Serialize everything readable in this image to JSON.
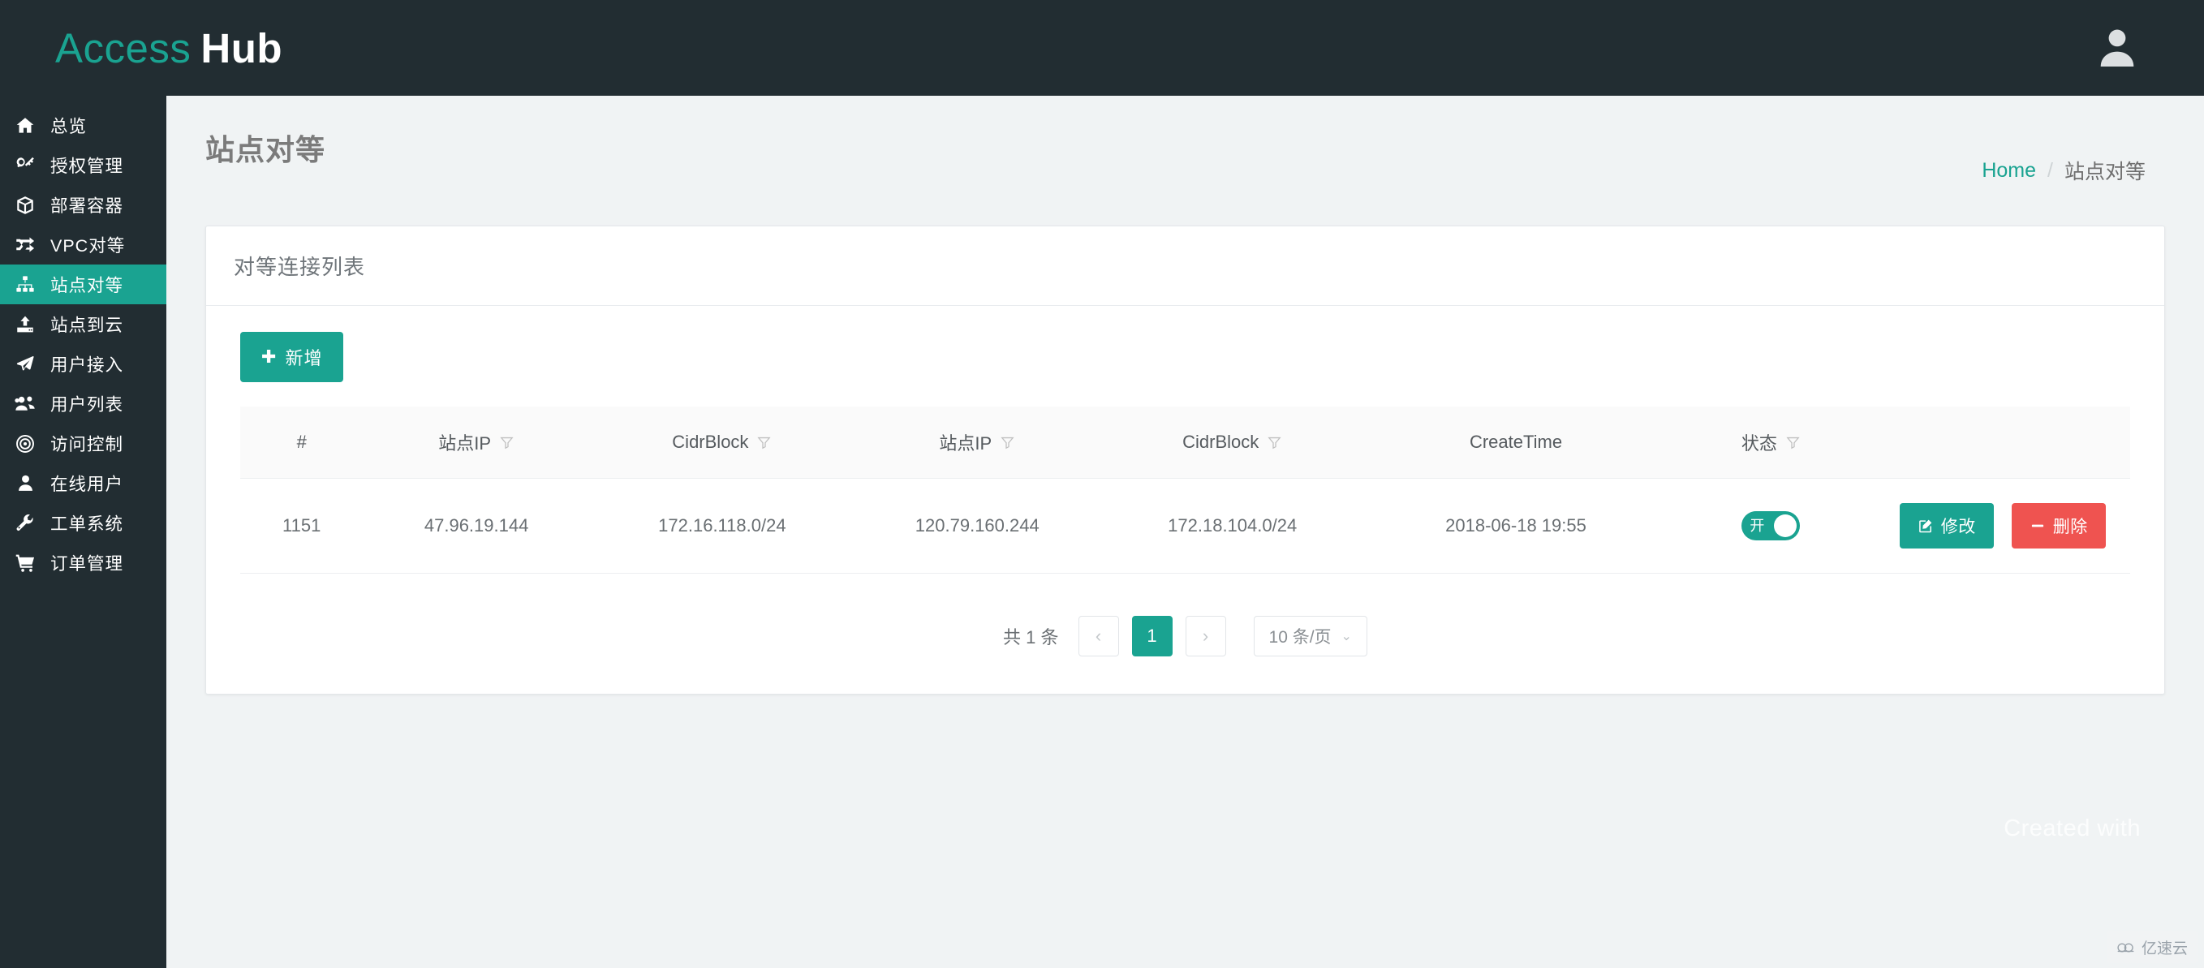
{
  "brand": {
    "first": "Access",
    "second": "Hub"
  },
  "header": {
    "avatar_icon": "user-avatar-icon"
  },
  "sidebar": {
    "items": [
      {
        "label": "总览",
        "icon": "home-icon",
        "active": false
      },
      {
        "label": "授权管理",
        "icon": "key-icon",
        "active": false
      },
      {
        "label": "部署容器",
        "icon": "box-icon",
        "active": false
      },
      {
        "label": "VPC对等",
        "icon": "shuffle-icon",
        "active": false
      },
      {
        "label": "站点对等",
        "icon": "sitemap-icon",
        "active": true
      },
      {
        "label": "站点到云",
        "icon": "upload-icon",
        "active": false
      },
      {
        "label": "用户接入",
        "icon": "plane-icon",
        "active": false
      },
      {
        "label": "用户列表",
        "icon": "users-icon",
        "active": false
      },
      {
        "label": "访问控制",
        "icon": "bullseye-icon",
        "active": false
      },
      {
        "label": "在线用户",
        "icon": "user-icon",
        "active": false
      },
      {
        "label": "工单系统",
        "icon": "wrench-icon",
        "active": false
      },
      {
        "label": "订单管理",
        "icon": "cart-icon",
        "active": false
      }
    ]
  },
  "page": {
    "title": "站点对等",
    "breadcrumb": {
      "home": "Home",
      "separator": "/",
      "current": "站点对等"
    }
  },
  "card": {
    "title": "对等连接列表",
    "add_button": {
      "label": "新增",
      "icon": "plus-icon"
    }
  },
  "table": {
    "columns": [
      {
        "label": "#",
        "filter": false
      },
      {
        "label": "站点IP",
        "filter": true
      },
      {
        "label": "CidrBlock",
        "filter": true
      },
      {
        "label": "站点IP",
        "filter": true
      },
      {
        "label": "CidrBlock",
        "filter": true
      },
      {
        "label": "CreateTime",
        "filter": false
      },
      {
        "label": "状态",
        "filter": true
      },
      {
        "label": "",
        "filter": false
      }
    ],
    "rows": [
      {
        "id": "1151",
        "site_ip_1": "47.96.19.144",
        "cidr_block_1": "172.16.118.0/24",
        "site_ip_2": "120.79.160.244",
        "cidr_block_2": "172.18.104.0/24",
        "create_time": "2018-06-18 19:55",
        "state_label": "开",
        "state_on": true,
        "edit_label": "修改",
        "delete_label": "删除"
      }
    ]
  },
  "pagination": {
    "total_text": "共 1 条",
    "prev": "‹",
    "next": "›",
    "current_page": "1",
    "page_size": "10 条/页",
    "caret": "⌄"
  },
  "watermark": {
    "text": "Created with"
  },
  "cloud_badge": {
    "text": "亿速云"
  },
  "colors": {
    "accent": "#1aa391",
    "sidebar_bg": "#222d32",
    "danger": "#ef5350",
    "page_bg": "#f0f3f4"
  }
}
